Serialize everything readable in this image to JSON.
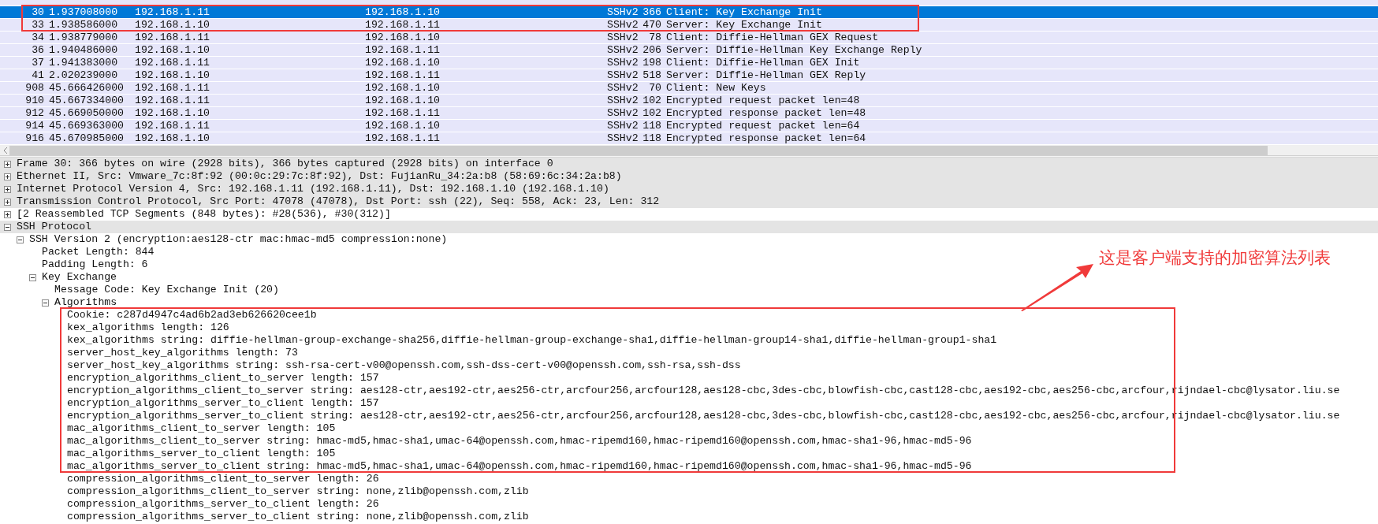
{
  "packet_list": {
    "rows": [
      {
        "no": "30",
        "time": "1.937008000",
        "source": "192.168.1.11",
        "destination": "192.168.1.10",
        "protocol": "SSHv2",
        "length": "366",
        "info": "Client: Key Exchange Init",
        "selected": true
      },
      {
        "no": "33",
        "time": "1.938586000",
        "source": "192.168.1.10",
        "destination": "192.168.1.11",
        "protocol": "SSHv2",
        "length": "470",
        "info": "Server: Key Exchange Init",
        "selected": false
      },
      {
        "no": "34",
        "time": "1.938779000",
        "source": "192.168.1.11",
        "destination": "192.168.1.10",
        "protocol": "SSHv2",
        "length": "78",
        "info": "Client: Diffie-Hellman GEX Request",
        "selected": false
      },
      {
        "no": "36",
        "time": "1.940486000",
        "source": "192.168.1.10",
        "destination": "192.168.1.11",
        "protocol": "SSHv2",
        "length": "206",
        "info": "Server: Diffie-Hellman Key Exchange Reply",
        "selected": false
      },
      {
        "no": "37",
        "time": "1.941383000",
        "source": "192.168.1.11",
        "destination": "192.168.1.10",
        "protocol": "SSHv2",
        "length": "198",
        "info": "Client: Diffie-Hellman GEX Init",
        "selected": false
      },
      {
        "no": "41",
        "time": "2.020239000",
        "source": "192.168.1.10",
        "destination": "192.168.1.11",
        "protocol": "SSHv2",
        "length": "518",
        "info": "Server: Diffie-Hellman GEX Reply",
        "selected": false
      },
      {
        "no": "908",
        "time": "45.666426000",
        "source": "192.168.1.11",
        "destination": "192.168.1.10",
        "protocol": "SSHv2",
        "length": "70",
        "info": "Client: New Keys",
        "selected": false
      },
      {
        "no": "910",
        "time": "45.667334000",
        "source": "192.168.1.11",
        "destination": "192.168.1.10",
        "protocol": "SSHv2",
        "length": "102",
        "info": "Encrypted request packet len=48",
        "selected": false
      },
      {
        "no": "912",
        "time": "45.669050000",
        "source": "192.168.1.10",
        "destination": "192.168.1.11",
        "protocol": "SSHv2",
        "length": "102",
        "info": "Encrypted response packet len=48",
        "selected": false
      },
      {
        "no": "914",
        "time": "45.669363000",
        "source": "192.168.1.11",
        "destination": "192.168.1.10",
        "protocol": "SSHv2",
        "length": "118",
        "info": "Encrypted request packet len=64",
        "selected": false
      },
      {
        "no": "916",
        "time": "45.670985000",
        "source": "192.168.1.10",
        "destination": "192.168.1.11",
        "protocol": "SSHv2",
        "length": "118",
        "info": "Encrypted response packet len=64",
        "selected": false
      }
    ]
  },
  "details": [
    {
      "text": "Frame 30: 366 bytes on wire (2928 bits), 366 bytes captured (2928 bits) on interface 0",
      "expanded": false,
      "shaded": true
    },
    {
      "text": "Ethernet II, Src: Vmware_7c:8f:92 (00:0c:29:7c:8f:92), Dst: FujianRu_34:2a:b8 (58:69:6c:34:2a:b8)",
      "expanded": false,
      "shaded": true
    },
    {
      "text": "Internet Protocol Version 4, Src: 192.168.1.11 (192.168.1.11), Dst: 192.168.1.10 (192.168.1.10)",
      "expanded": false,
      "shaded": true
    },
    {
      "text": "Transmission Control Protocol, Src Port: 47078 (47078), Dst Port: ssh (22), Seq: 558, Ack: 23, Len: 312",
      "expanded": false,
      "shaded": true
    },
    {
      "text": "[2 Reassembled TCP Segments (848 bytes): #28(536), #30(312)]",
      "expanded": false,
      "shaded": false
    },
    {
      "text": "SSH Protocol",
      "expanded": true,
      "shaded": true,
      "children": [
        {
          "text": "SSH Version 2 (encryption:aes128-ctr mac:hmac-md5 compression:none)",
          "expanded": true,
          "shaded": false,
          "children": [
            {
              "text": "Packet Length: 844",
              "shaded": false
            },
            {
              "text": "Padding Length: 6",
              "shaded": false
            },
            {
              "text": "Key Exchange",
              "expanded": true,
              "shaded": false,
              "children": [
                {
                  "text": "Message Code: Key Exchange Init (20)",
                  "shaded": false
                },
                {
                  "text": "Algorithms",
                  "expanded": true,
                  "shaded": false,
                  "children": [
                    {
                      "text": "Cookie: c287d4947c4ad6b2ad3eb626620cee1b",
                      "shaded": false
                    },
                    {
                      "text": "kex_algorithms length: 126",
                      "shaded": false
                    },
                    {
                      "text": "kex_algorithms string: diffie-hellman-group-exchange-sha256,diffie-hellman-group-exchange-sha1,diffie-hellman-group14-sha1,diffie-hellman-group1-sha1",
                      "shaded": false
                    },
                    {
                      "text": "server_host_key_algorithms length: 73",
                      "shaded": false
                    },
                    {
                      "text": "server_host_key_algorithms string: ssh-rsa-cert-v00@openssh.com,ssh-dss-cert-v00@openssh.com,ssh-rsa,ssh-dss",
                      "shaded": false
                    },
                    {
                      "text": "encryption_algorithms_client_to_server length: 157",
                      "shaded": false
                    },
                    {
                      "text": "encryption_algorithms_client_to_server string: aes128-ctr,aes192-ctr,aes256-ctr,arcfour256,arcfour128,aes128-cbc,3des-cbc,blowfish-cbc,cast128-cbc,aes192-cbc,aes256-cbc,arcfour,rijndael-cbc@lysator.liu.se",
                      "shaded": false
                    },
                    {
                      "text": "encryption_algorithms_server_to_client length: 157",
                      "shaded": false
                    },
                    {
                      "text": "encryption_algorithms_server_to_client string: aes128-ctr,aes192-ctr,aes256-ctr,arcfour256,arcfour128,aes128-cbc,3des-cbc,blowfish-cbc,cast128-cbc,aes192-cbc,aes256-cbc,arcfour,rijndael-cbc@lysator.liu.se",
                      "shaded": false
                    },
                    {
                      "text": "mac_algorithms_client_to_server length: 105",
                      "shaded": false
                    },
                    {
                      "text": "mac_algorithms_client_to_server string: hmac-md5,hmac-sha1,umac-64@openssh.com,hmac-ripemd160,hmac-ripemd160@openssh.com,hmac-sha1-96,hmac-md5-96",
                      "shaded": false
                    },
                    {
                      "text": "mac_algorithms_server_to_client length: 105",
                      "shaded": false
                    },
                    {
                      "text": "mac_algorithms_server_to_client string: hmac-md5,hmac-sha1,umac-64@openssh.com,hmac-ripemd160,hmac-ripemd160@openssh.com,hmac-sha1-96,hmac-md5-96",
                      "shaded": false
                    },
                    {
                      "text": "compression_algorithms_client_to_server length: 26",
                      "shaded": false
                    },
                    {
                      "text": "compression_algorithms_client_to_server string: none,zlib@openssh.com,zlib",
                      "shaded": false
                    },
                    {
                      "text": "compression_algorithms_server_to_client length: 26",
                      "shaded": false
                    },
                    {
                      "text": "compression_algorithms_server_to_client string: none,zlib@openssh.com,zlib",
                      "shaded": false
                    }
                  ]
                }
              ]
            }
          ]
        }
      ]
    }
  ],
  "annotation": {
    "text": "这是客户端支持的加密算法列表"
  }
}
